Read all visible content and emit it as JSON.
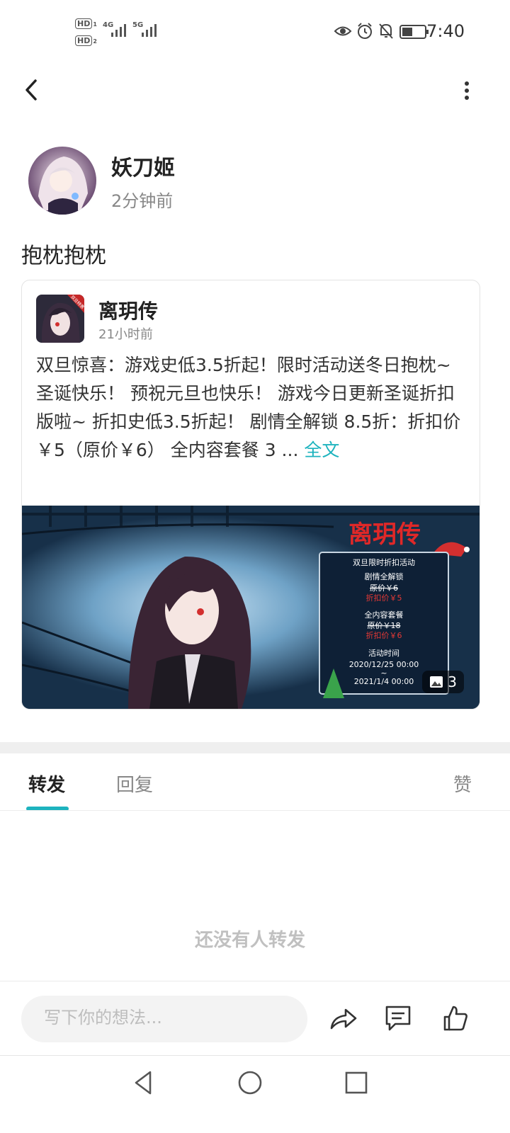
{
  "status_bar": {
    "hd1": "HD",
    "hd1_sub": "1",
    "hd2": "HD",
    "hd2_sub": "2",
    "net1": "4G",
    "net2": "5G",
    "time": "7:40",
    "icons": [
      "eye-icon",
      "alarm-icon",
      "bell-off-icon",
      "battery-icon"
    ]
  },
  "header": {
    "back_icon": "chevron-left-icon",
    "more_icon": "more-vertical-icon"
  },
  "post": {
    "author": "妖刀姬",
    "time": "2分钟前",
    "text": "抱枕抱枕"
  },
  "shared": {
    "name": "离玥传",
    "time": "21小时前",
    "line1": "双旦惊喜：游戏史低3.5折起！限时活动送冬日抱枕~",
    "line2": "圣诞快乐！ 预祝元旦也快乐！ 游戏今日更新圣诞折扣版啦~ 折扣史低3.5折起！ 剧情全解锁 8.5折：折扣价￥5（原价￥6） 全内容套餐 3 ...",
    "full_link": "全文",
    "image": {
      "logo": "离玥传",
      "box_title": "双旦限时折扣活动",
      "item1": "剧情全解锁",
      "item1_orig": "原价￥6",
      "item1_sale": "折扣价￥5",
      "item2": "全内容套餐",
      "item2_orig": "原价￥18",
      "item2_sale": "折扣价￥6",
      "period_label": "活动时间",
      "period_start": "2020/12/25 00:00",
      "period_sep": "~",
      "period_end": "2021/1/4 00:00",
      "count": "3",
      "badge": "双旦特惠"
    }
  },
  "tabs": {
    "forward": "转发",
    "reply": "回复",
    "like": "赞"
  },
  "empty_text": "还没有人转发",
  "comment": {
    "placeholder": "写下你的想法..."
  },
  "colors": {
    "accent": "#1db3be",
    "sale_red": "#e53935"
  }
}
